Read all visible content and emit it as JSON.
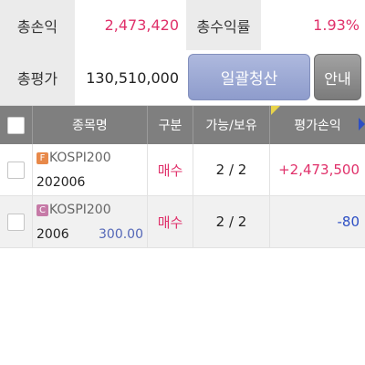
{
  "summary": {
    "total_pnl_label": "총손익",
    "total_pnl_value": "2,473,420",
    "total_return_label": "총수익률",
    "total_return_value": "1.93%",
    "total_valuation_label": "총평가",
    "total_valuation_value": "130,510,000"
  },
  "buttons": {
    "settle_all": "일괄청산",
    "info": "안내"
  },
  "table": {
    "headers": [
      "종목명",
      "구분",
      "가능/보유",
      "평가손익"
    ],
    "rows": [
      {
        "badge": "F",
        "name": "KOSPI200",
        "code": "202006",
        "strike": "",
        "side": "매수",
        "qty": "2 / 2",
        "pnl": "+2,473,500"
      },
      {
        "badge": "C",
        "name": "KOSPI200",
        "code": "2006",
        "strike": "300.00",
        "side": "매수",
        "qty": "2 / 2",
        "pnl": "-80"
      }
    ]
  },
  "colors": {
    "positive": "#e0306a",
    "negative": "#2d4fc4",
    "header_bg": "#7f7f7f"
  }
}
